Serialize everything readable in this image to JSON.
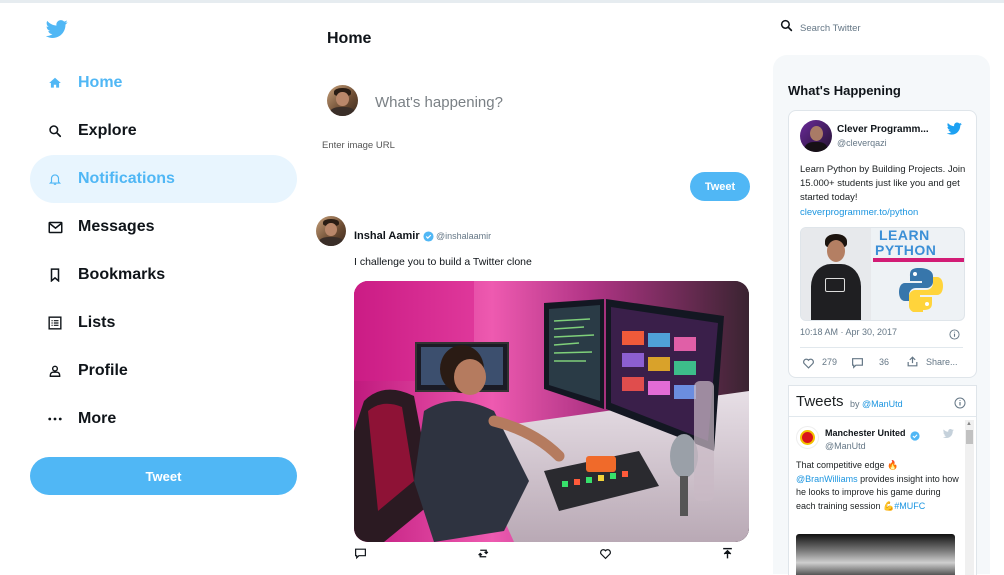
{
  "sidebar": {
    "items": [
      {
        "label": "Home",
        "icon": "home-icon"
      },
      {
        "label": "Explore",
        "icon": "search-icon"
      },
      {
        "label": "Notifications",
        "icon": "bell-icon"
      },
      {
        "label": "Messages",
        "icon": "mail-icon"
      },
      {
        "label": "Bookmarks",
        "icon": "bookmark-icon"
      },
      {
        "label": "Lists",
        "icon": "list-icon"
      },
      {
        "label": "Profile",
        "icon": "person-icon"
      },
      {
        "label": "More",
        "icon": "more-icon"
      }
    ],
    "tweet_button": "Tweet"
  },
  "feed": {
    "title": "Home",
    "compose": {
      "placeholder": "What's happening?",
      "image_url_placeholder": "Enter image URL",
      "tweet_button": "Tweet"
    },
    "post": {
      "display_name": "Inshal Aamir",
      "username": "@inshalaamir",
      "text": "I challenge you to build a Twitter clone",
      "actions": [
        "reply-icon",
        "retweet-icon",
        "like-icon",
        "share-icon"
      ]
    }
  },
  "search": {
    "placeholder": "Search Twitter"
  },
  "widgets": {
    "title": "What's Happening",
    "tweet_card": {
      "name": "Clever Programm...",
      "handle": "@cleverqazi",
      "text": "Learn Python by Building Projects. Join 15.000+ students just like you and get started today!",
      "link": "cleverprogrammer.to/python",
      "image_text_1": "LEARN",
      "image_text_2": "PYTHON",
      "timestamp": "10:18 AM · Apr 30, 2017",
      "likes": "279",
      "replies": "36",
      "share": "Share..."
    },
    "embed": {
      "title": "Tweets",
      "by": "by",
      "account_link": "@ManUtd",
      "tweet": {
        "name": "Manchester United",
        "handle": "@ManUtd",
        "line1": "That competitive edge",
        "mention": "@BranWilliams",
        "line2": " provides insight into how he looks to improve his game during each training session",
        "hashtag": "#MUFC"
      }
    }
  },
  "colors": {
    "accent": "#50b7f5",
    "active_bg": "#e8f5fe",
    "link": "#1b95e0"
  }
}
